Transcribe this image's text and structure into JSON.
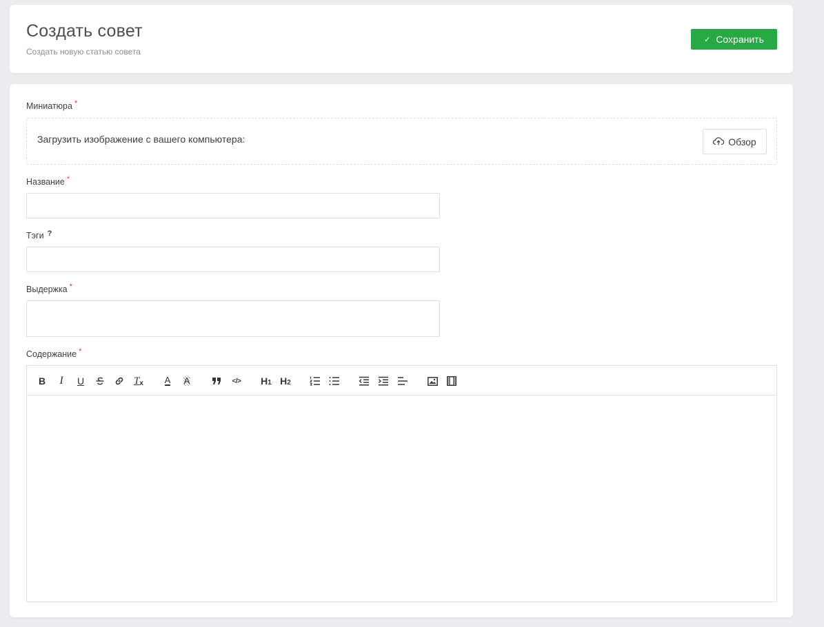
{
  "header": {
    "title": "Создать совет",
    "subtitle": "Создать новую статью совета",
    "save_label": "Сохранить"
  },
  "form": {
    "thumbnail": {
      "label": "Миниатюра",
      "required_mark": "*",
      "upload_text": "Загрузить изображение с вашего компьютера:",
      "browse_label": "Обзор"
    },
    "name": {
      "label": "Название",
      "required_mark": "*",
      "value": ""
    },
    "tags": {
      "label": "Тэги",
      "hint_mark": "?",
      "value": ""
    },
    "excerpt": {
      "label": "Выдержка",
      "required_mark": "*",
      "value": ""
    },
    "content": {
      "label": "Содержание",
      "required_mark": "*",
      "toolbar": [
        "bold-icon",
        "italic-icon",
        "underline-icon",
        "strikethrough-icon",
        "link-icon",
        "clear-format-icon",
        "text-color-icon",
        "background-color-icon",
        "blockquote-icon",
        "code-icon",
        "heading-1-icon",
        "heading-2-icon",
        "ordered-list-icon",
        "bullet-list-icon",
        "outdent-icon",
        "indent-icon",
        "align-icon",
        "image-icon",
        "video-icon"
      ],
      "toolbar_text": {
        "bold": "B",
        "italic": "I",
        "underline": "U",
        "h1": "H",
        "h1_sub": "1",
        "h2": "H",
        "h2_sub": "2",
        "quote": "❞",
        "code": "</>",
        "clear": "T",
        "clear_sub": "x",
        "color": "A",
        "bgcolor": "A"
      }
    }
  },
  "colors": {
    "accent_green": "#28a745",
    "required_red": "#e0344a",
    "background": "#ebecef"
  }
}
